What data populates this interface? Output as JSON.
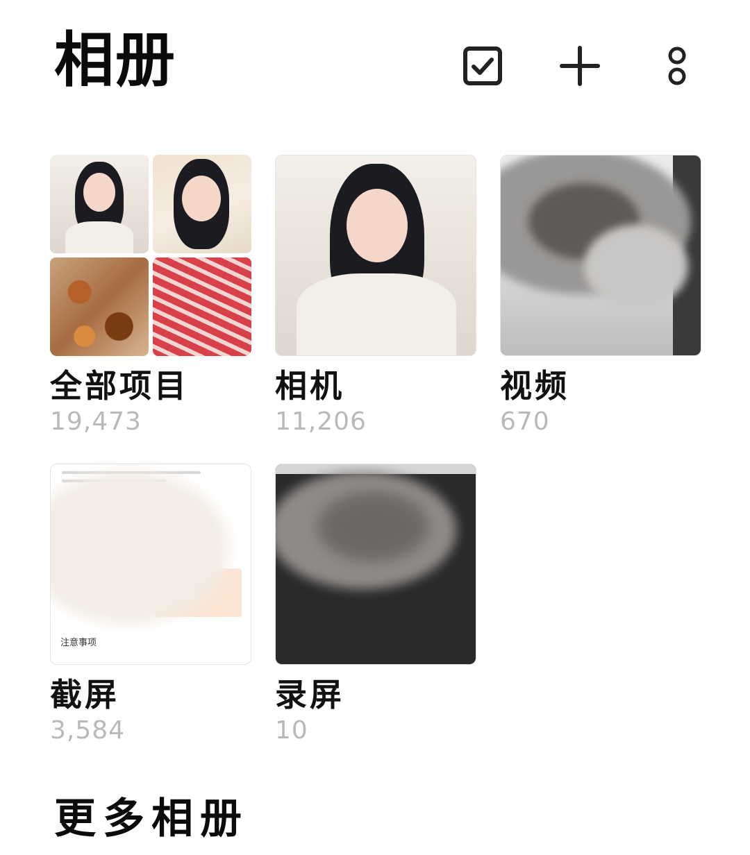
{
  "header": {
    "title": "相册",
    "actions": [
      {
        "name": "select",
        "icon": "checkbox-icon"
      },
      {
        "name": "add",
        "icon": "plus-icon"
      },
      {
        "name": "more",
        "icon": "more-vertical-icon"
      }
    ]
  },
  "albums": [
    {
      "name": "全部项目",
      "count": "19,473"
    },
    {
      "name": "相机",
      "count": "11,206"
    },
    {
      "name": "视频",
      "count": "670"
    },
    {
      "name": "截屏",
      "count": "3,584"
    },
    {
      "name": "录屏",
      "count": "10"
    }
  ],
  "screenshot_thumb_text": "注意事项",
  "more_albums": {
    "title": "更多相册"
  },
  "colors": {
    "background": "#ffffff",
    "text_primary": "#111111",
    "text_secondary": "#b9b9b9"
  }
}
